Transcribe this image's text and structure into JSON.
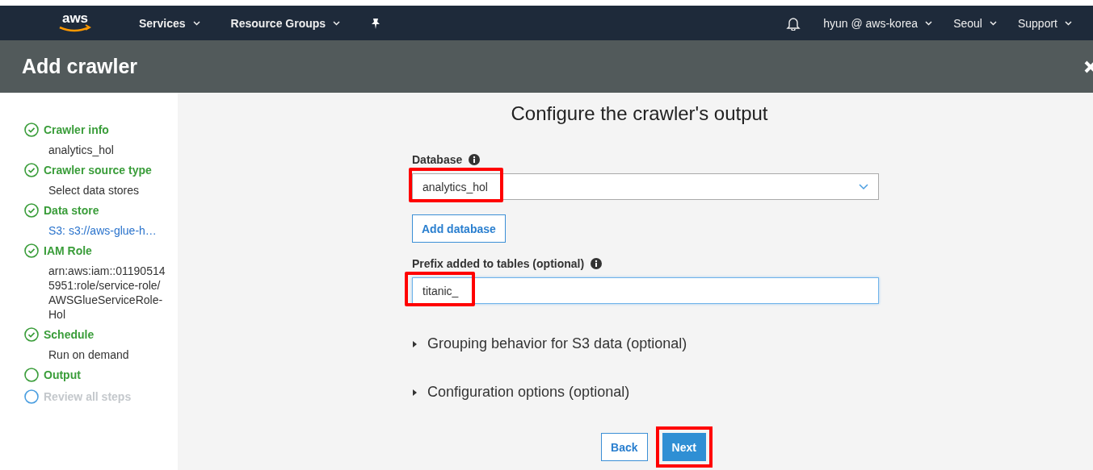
{
  "nav": {
    "logo": "aws",
    "menus": [
      {
        "label": "Services"
      },
      {
        "label": "Resource Groups"
      }
    ],
    "account": [
      {
        "label": "hyun @ aws-korea"
      },
      {
        "label": "Seoul"
      },
      {
        "label": "Support"
      }
    ]
  },
  "header": {
    "title": "Add crawler"
  },
  "steps": [
    {
      "label": "Crawler info",
      "kind": "done",
      "detail": "analytics_hol",
      "link": false
    },
    {
      "label": "Crawler source type",
      "kind": "done",
      "detail": "Select data stores",
      "link": false
    },
    {
      "label": "Data store",
      "kind": "done",
      "detail": "S3: s3://aws-glue-h…",
      "link": true
    },
    {
      "label": "IAM Role",
      "kind": "done",
      "detail": "arn:aws:iam::011905145951:role/service-role/AWSGlueServiceRole-Hol",
      "link": false
    },
    {
      "label": "Schedule",
      "kind": "done",
      "detail": "Run on demand",
      "link": false
    },
    {
      "label": "Output",
      "kind": "current"
    },
    {
      "label": "Review all steps",
      "kind": "pending"
    }
  ],
  "form": {
    "title": "Configure the crawler's output",
    "database": {
      "label": "Database",
      "value": "analytics_hol",
      "highlighted": true
    },
    "add_button": "Add database",
    "prefix": {
      "label": "Prefix added to tables (optional)",
      "value": "titanic_",
      "highlighted": true
    },
    "sections": [
      {
        "label": "Grouping behavior for S3 data (optional)",
        "expanded": false
      },
      {
        "label": "Configuration options (optional)",
        "expanded": false
      }
    ],
    "buttons": [
      {
        "label": "Back",
        "kind": "secondary",
        "highlighted": false
      },
      {
        "label": "Next",
        "kind": "primary",
        "highlighted": true
      }
    ]
  }
}
